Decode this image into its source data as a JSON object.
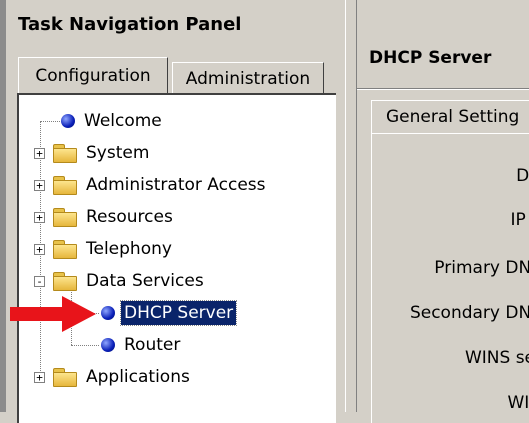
{
  "left": {
    "title": "Task Navigation Panel",
    "tabs": [
      {
        "label": "Configuration"
      },
      {
        "label": "Administration"
      }
    ],
    "tree": [
      {
        "label": "Welcome",
        "icon": "blue-ball-icon"
      },
      {
        "label": "System",
        "icon": "folder-icon",
        "expander": "+"
      },
      {
        "label": "Administrator Access",
        "icon": "folder-icon",
        "expander": "+"
      },
      {
        "label": "Resources",
        "icon": "folder-icon",
        "expander": "+"
      },
      {
        "label": "Telephony",
        "icon": "folder-icon",
        "expander": "+"
      },
      {
        "label": "Data Services",
        "icon": "folder-icon",
        "expander": "-"
      },
      {
        "label": "DHCP Server",
        "icon": "blue-ball-icon",
        "selected": true
      },
      {
        "label": "Router",
        "icon": "blue-ball-icon"
      },
      {
        "label": "Applications",
        "icon": "folder-icon",
        "expander": "+"
      }
    ]
  },
  "right": {
    "title": "DHCP Server",
    "tab": "General Setting",
    "fields": [
      "DH",
      "IP d",
      "Primary DNS",
      "Secondary DNS",
      "WINS ser",
      "WIN"
    ]
  },
  "colors": {
    "selection": "#0a246a",
    "arrow": "#e8141a",
    "background": "#d4d0c8"
  }
}
